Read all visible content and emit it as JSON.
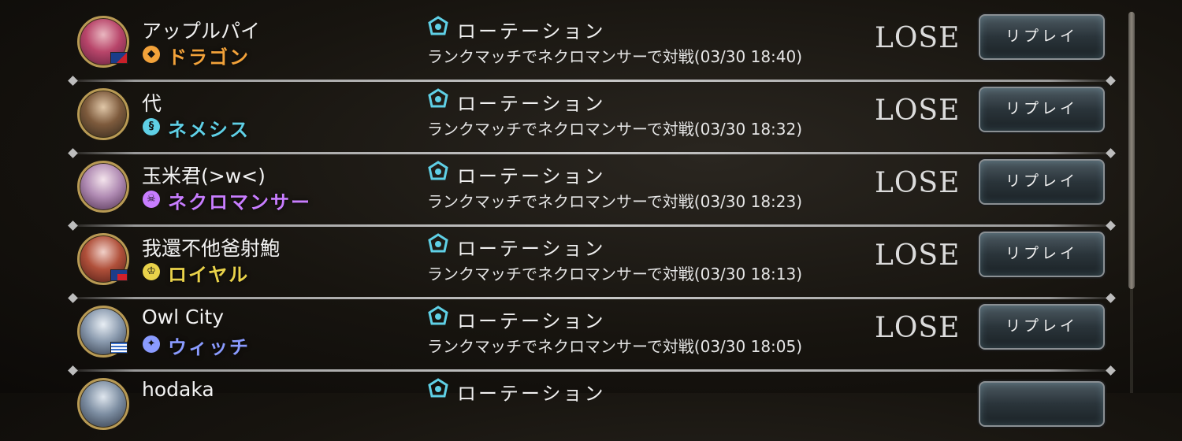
{
  "colors": {
    "dragon": "#f2a23a",
    "nemesis": "#5fd0e6",
    "necromancer": "#c87dff",
    "royal": "#e9d24a",
    "witch": "#8a9bff",
    "result": "#dcdcdc"
  },
  "matches": [
    {
      "player_name": "アップルパイ",
      "class_name": "ドラゴン",
      "class_icon": "dragon-class-icon",
      "mode": "ローテーション",
      "description": "ランクマッチでネクロマンサーで対戦(03/30 18:40)",
      "result": "LOSE",
      "replay_label": "リプレイ"
    },
    {
      "player_name": "代",
      "class_name": "ネメシス",
      "class_icon": "nemesis-class-icon",
      "mode": "ローテーション",
      "description": "ランクマッチでネクロマンサーで対戦(03/30 18:32)",
      "result": "LOSE",
      "replay_label": "リプレイ"
    },
    {
      "player_name": "玉米君(>w<)",
      "class_name": "ネクロマンサー",
      "class_icon": "necromancer-class-icon",
      "mode": "ローテーション",
      "description": "ランクマッチでネクロマンサーで対戦(03/30 18:23)",
      "result": "LOSE",
      "replay_label": "リプレイ"
    },
    {
      "player_name": "我還不他爸射鮑",
      "class_name": "ロイヤル",
      "class_icon": "royal-class-icon",
      "mode": "ローテーション",
      "description": "ランクマッチでネクロマンサーで対戦(03/30 18:13)",
      "result": "LOSE",
      "replay_label": "リプレイ"
    },
    {
      "player_name": "Owl City",
      "class_name": "ウィッチ",
      "class_icon": "witch-class-icon",
      "mode": "ローテーション",
      "description": "ランクマッチでネクロマンサーで対戦(03/30 18:05)",
      "result": "LOSE",
      "replay_label": "リプレイ"
    },
    {
      "player_name": "hodaka",
      "mode": "ローテーション"
    }
  ]
}
